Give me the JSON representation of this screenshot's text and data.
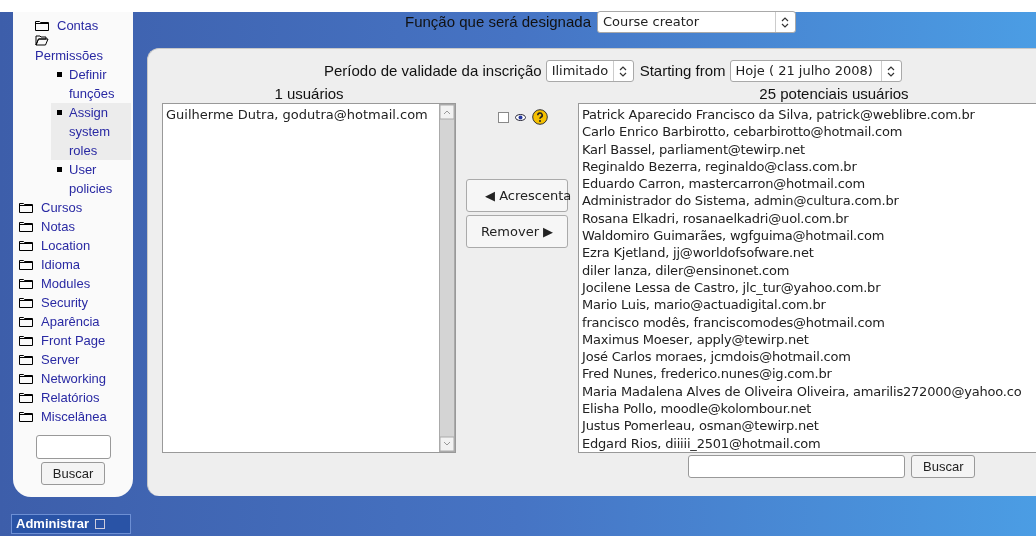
{
  "sidebar": {
    "items": [
      {
        "label": "Contas",
        "kind": "folder",
        "expanded": false
      },
      {
        "label": "Permissões",
        "kind": "folder",
        "expanded": true,
        "children": [
          {
            "label": "Definir funções",
            "kind": "page",
            "selected": false
          },
          {
            "label": "Assign system roles",
            "kind": "page",
            "selected": true
          },
          {
            "label": "User policies",
            "kind": "page",
            "selected": false
          }
        ]
      }
    ],
    "top_items": [
      {
        "label": "Cursos",
        "kind": "folder",
        "expanded": false
      },
      {
        "label": "Notas",
        "kind": "folder",
        "expanded": false
      },
      {
        "label": "Location",
        "kind": "folder",
        "expanded": false
      },
      {
        "label": "Idioma",
        "kind": "folder",
        "expanded": false
      },
      {
        "label": "Modules",
        "kind": "folder",
        "expanded": false
      },
      {
        "label": "Security",
        "kind": "folder",
        "expanded": false
      },
      {
        "label": "Aparência",
        "kind": "folder",
        "expanded": false
      },
      {
        "label": "Front Page",
        "kind": "folder",
        "expanded": false
      },
      {
        "label": "Server",
        "kind": "folder",
        "expanded": false
      },
      {
        "label": "Networking",
        "kind": "folder",
        "expanded": false
      },
      {
        "label": "Relatórios",
        "kind": "folder",
        "expanded": false
      },
      {
        "label": "Miscelânea",
        "kind": "folder",
        "expanded": false
      }
    ],
    "search_button": "Buscar"
  },
  "admin_block": {
    "title": "Administrar"
  },
  "role": {
    "label": "Função que será designada",
    "value": "Course creator"
  },
  "enrolment": {
    "label": "Período de validade da inscrição",
    "value": "Ilimitado"
  },
  "starting": {
    "label": "Starting from",
    "value": "Hoje ( 21 julho 2008)"
  },
  "existing": {
    "heading": "1 usuários",
    "users": [
      "Guilherme Dutra, godutra@hotmail.com"
    ]
  },
  "show_details": {
    "checked": false
  },
  "add_button": "◀ Acrescenta",
  "remove_button": "Remover ▶",
  "potential": {
    "heading": "25 potenciais usuários",
    "users": [
      "Patrick Aparecido Francisco da Silva, patrick@weblibre.com.br",
      "Carlo Enrico Barbirotto, cebarbirotto@hotmail.com",
      "Karl Bassel, parliament@tewirp.net",
      "Reginaldo Bezerra, reginaldo@class.com.br",
      "Eduardo Carron, mastercarron@hotmail.com",
      "Administrador do Sistema, admin@cultura.com.br",
      "Rosana Elkadri, rosanaelkadri@uol.com.br",
      "Waldomiro Guimarães, wgfguima@hotmail.com",
      "Ezra Kjetland, jj@worldofsofware.net",
      "diler lanza, diler@ensinonet.com",
      "Jocilene Lessa de Castro, jlc_tur@yahoo.com.br",
      "Mario Luis, mario@actuadigital.com.br",
      "francisco modês, franciscomodes@hotmail.com",
      "Maximus Moeser, apply@tewirp.net",
      "José Carlos moraes, jcmdois@hotmail.com",
      "Fred Nunes, frederico.nunes@ig.com.br",
      "Maria Madalena Alves de Oliveira Oliveira, amarilis272000@yahoo.co",
      "Elisha Pollo, moodle@kolombour.net",
      "Justus Pomerleau, osman@tewirp.net",
      "Edgard Rios, diiiii_2501@hotmail.com"
    ],
    "search_button": "Buscar"
  }
}
